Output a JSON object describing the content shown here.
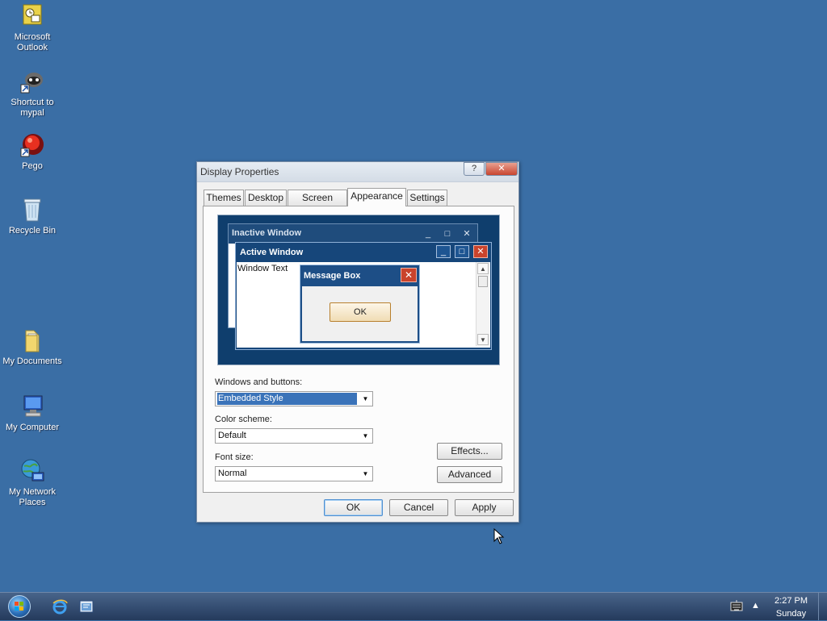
{
  "desktop": {
    "icons": [
      {
        "label": "Microsoft Outlook",
        "icon": "outlook-icon"
      },
      {
        "label": "Shortcut to mypal",
        "icon": "mypal-icon"
      },
      {
        "label": "Pego",
        "icon": "pego-icon"
      },
      {
        "label": "Recycle Bin",
        "icon": "recycle-bin-icon"
      },
      {
        "label": "My Documents",
        "icon": "folder-icon"
      },
      {
        "label": "My Computer",
        "icon": "computer-icon"
      },
      {
        "label": "My Network Places",
        "icon": "network-icon"
      }
    ]
  },
  "dialog": {
    "title": "Display Properties",
    "help": "?",
    "close": "✕",
    "tabs": [
      "Themes",
      "Desktop",
      "Screen Saver",
      "Appearance",
      "Settings"
    ],
    "active_tab": "Appearance",
    "preview": {
      "inactive_title": "Inactive Window",
      "active_title": "Active Window",
      "window_text": "Window Text",
      "message_title": "Message Box",
      "ok": "OK"
    },
    "windows_buttons_label": "Windows and buttons:",
    "windows_buttons_value": "Embedded Style",
    "color_scheme_label": "Color scheme:",
    "color_scheme_value": "Default",
    "font_size_label": "Font size:",
    "font_size_value": "Normal",
    "effects": "Effects...",
    "advanced": "Advanced",
    "ok": "OK",
    "cancel": "Cancel",
    "apply": "Apply"
  },
  "taskbar": {
    "time": "2:27 PM",
    "day": "Sunday",
    "tray_arrow": "▲"
  },
  "colors": {
    "desktop": "#3a6ea5",
    "accent": "#3a73b9"
  }
}
